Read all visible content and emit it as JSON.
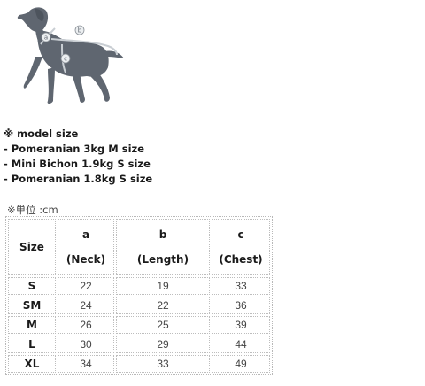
{
  "illustration": {
    "markers": [
      "a",
      "b",
      "c"
    ],
    "colors": {
      "dog": "#5f6670",
      "outline": "#c9ced3"
    }
  },
  "model_notes": {
    "title": "※ model size",
    "lines": [
      "- Pomeranian 3kg  M size",
      "- Mini Bichon 1.9kg  S size",
      "- Pomeranian 1.8kg  S size"
    ]
  },
  "unit_label": "※単位 :cm",
  "size_table": {
    "header": {
      "size": "Size",
      "a_letter": "a",
      "a_name": "(Neck)",
      "b_letter": "b",
      "b_name": "(Length)",
      "c_letter": "c",
      "c_name": "(Chest)"
    },
    "rows": [
      {
        "size": "S",
        "neck": "22",
        "length": "19",
        "chest": "33"
      },
      {
        "size": "SM",
        "neck": "24",
        "length": "22",
        "chest": "36"
      },
      {
        "size": "M",
        "neck": "26",
        "length": "25",
        "chest": "39"
      },
      {
        "size": "L",
        "neck": "30",
        "length": "29",
        "chest": "44"
      },
      {
        "size": "XL",
        "neck": "34",
        "length": "33",
        "chest": "49"
      }
    ]
  }
}
